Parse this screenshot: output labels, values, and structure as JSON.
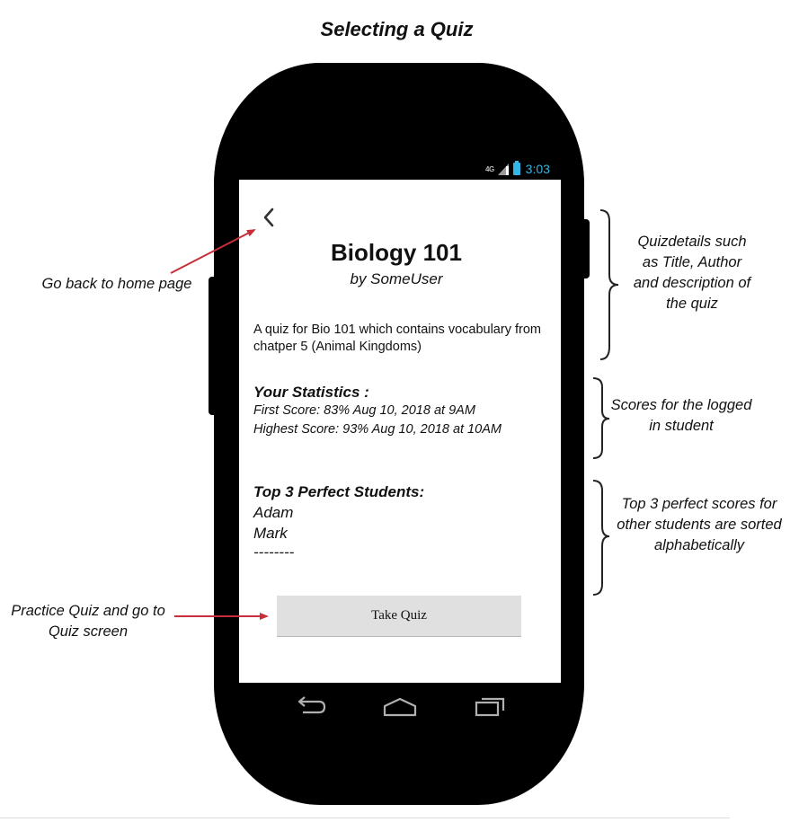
{
  "page_title": "Selecting a Quiz",
  "status_bar": {
    "network": "4G",
    "time": "3:03",
    "accent_color": "#33b5e5"
  },
  "screen": {
    "back_icon": "chevron-left-icon",
    "quiz_title": "Biology 101",
    "quiz_author": "by SomeUser",
    "quiz_description": "A quiz for Bio 101 which contains vocabulary from chatper 5 (Animal Kingdoms)",
    "statistics": {
      "heading": "Your Statistics :",
      "first_score": "First Score: 83% Aug 10, 2018 at 9AM",
      "highest_score": "Highest Score: 93% Aug 10, 2018 at 10AM"
    },
    "top_students": {
      "heading": "Top 3 Perfect Students:",
      "names": [
        "Adam",
        "Mark",
        "--------"
      ]
    },
    "take_quiz_label": "Take Quiz"
  },
  "nav_bar": {
    "icons": [
      "back-nav-icon",
      "home-nav-icon",
      "recents-nav-icon"
    ]
  },
  "annotations": {
    "back": "Go back to home page",
    "practice": "Practice Quiz and go to Quiz screen",
    "details": "Quizdetails such as Title, Author and description of the quiz",
    "scores": "Scores for the logged in student",
    "top3": "Top 3 perfect scores for other students are sorted alphabetically"
  },
  "colors": {
    "arrow": "#c62f3a",
    "phone_body": "#000000",
    "button_bg": "#e0e0e0"
  }
}
